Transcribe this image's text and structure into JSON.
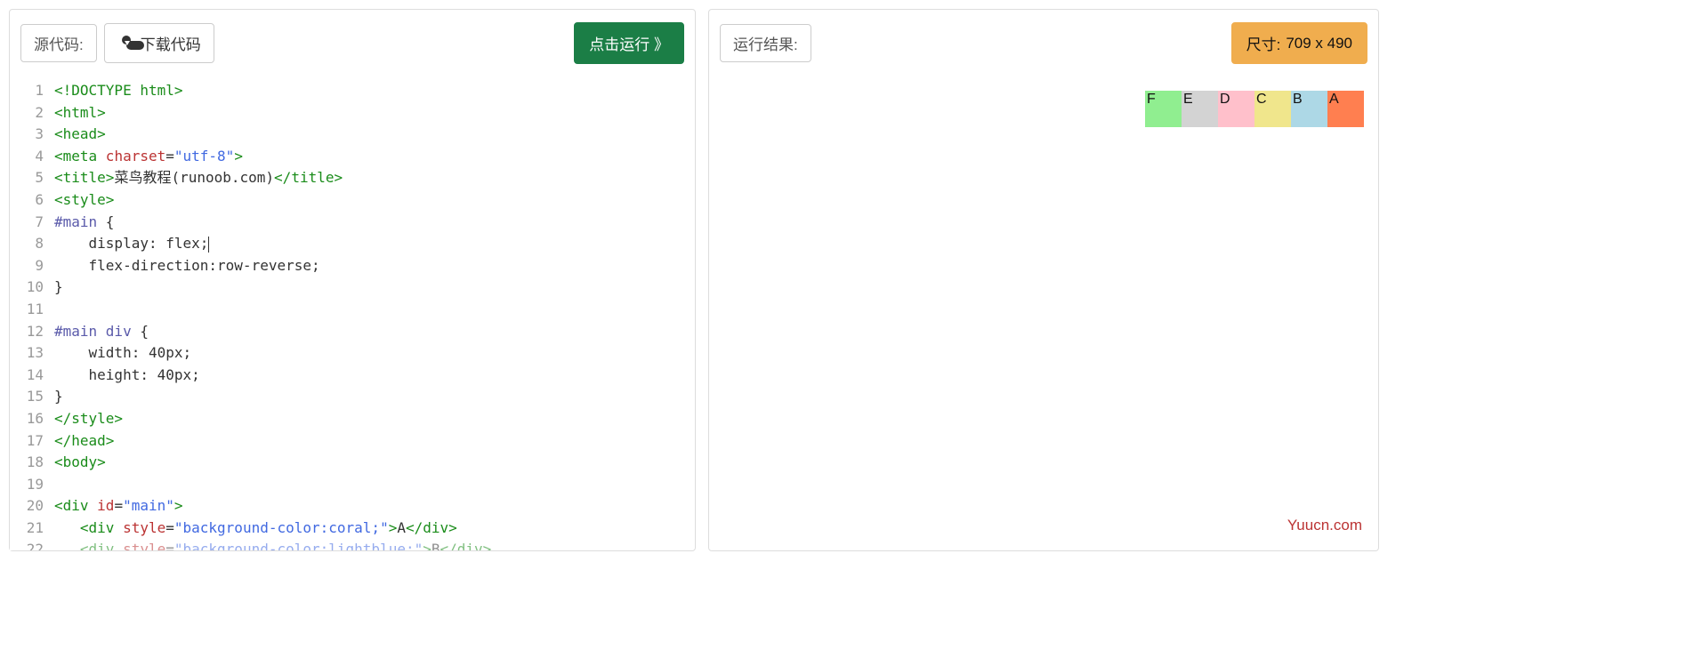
{
  "left": {
    "label": "源代码:",
    "download_label": "下载代码",
    "run_label": "点击运行 》"
  },
  "right": {
    "label": "运行结果:",
    "size_prefix": "尺寸: ",
    "size_value": "709 x 490"
  },
  "preview_boxes": [
    {
      "letter": "A",
      "bg": "coral"
    },
    {
      "letter": "B",
      "bg": "lightblue"
    },
    {
      "letter": "C",
      "bg": "khaki"
    },
    {
      "letter": "D",
      "bg": "pink"
    },
    {
      "letter": "E",
      "bg": "lightgrey"
    },
    {
      "letter": "F",
      "bg": "lightgreen"
    }
  ],
  "watermark": "Yuucn.com",
  "code": {
    "line_count": 22,
    "l1_a": "<!DOCTYPE html>",
    "l2_a": "<html>",
    "l3_a": "<head>",
    "l4_a": "<meta",
    "l4_b": " charset",
    "l4_c": "=",
    "l4_d": "\"utf-8\"",
    "l4_e": ">",
    "l5_a": "<title>",
    "l5_b": "菜鸟教程(runoob.com)",
    "l5_c": "</title>",
    "l6_a": "<style>",
    "l7_a": "#main",
    "l7_b": " {",
    "l8_a": "    display",
    "l8_b": ":",
    "l8_c": " flex",
    "l8_d": ";",
    "l9_a": "    flex-direction",
    "l9_b": ":",
    "l9_c": "row-reverse",
    "l9_d": ";",
    "l10_a": "}",
    "l11_a": "",
    "l12_a": "#main div",
    "l12_b": " {",
    "l13_a": "    width",
    "l13_b": ":",
    "l13_c": " 40px",
    "l13_d": ";",
    "l14_a": "    height",
    "l14_b": ":",
    "l14_c": " 40px",
    "l14_d": ";",
    "l15_a": "}",
    "l16_a": "</style>",
    "l17_a": "</head>",
    "l18_a": "<body>",
    "l19_a": "",
    "l20_a": "<div",
    "l20_b": " id",
    "l20_c": "=",
    "l20_d": "\"main\"",
    "l20_e": ">",
    "l21_a": "   ",
    "l21_b": "<div",
    "l21_c": " style",
    "l21_d": "=",
    "l21_e": "\"background-color:coral;\"",
    "l21_f": ">",
    "l21_g": "A",
    "l21_h": "</div>",
    "l22_a": "   ",
    "l22_b": "<div",
    "l22_c": " style",
    "l22_d": "=",
    "l22_e": "\"background-color:lightblue;\"",
    "l22_f": ">",
    "l22_g": "B",
    "l22_h": "</div>"
  }
}
